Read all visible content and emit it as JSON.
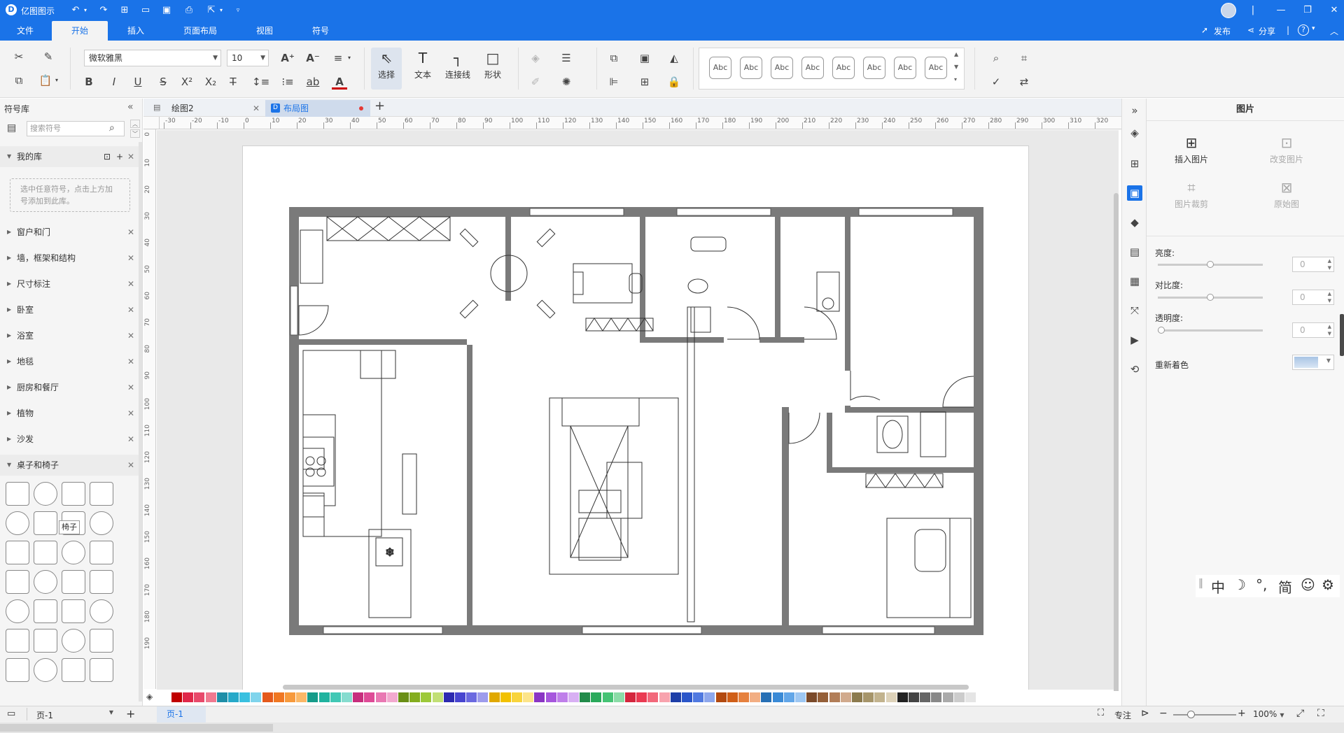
{
  "app": {
    "title": "亿图图示"
  },
  "menu": {
    "tabs": [
      {
        "label": "文件"
      },
      {
        "label": "开始"
      },
      {
        "label": "插入"
      },
      {
        "label": "页面布局"
      },
      {
        "label": "视图"
      },
      {
        "label": "符号"
      }
    ],
    "publish": "发布",
    "share": "分享",
    "help": "?"
  },
  "ribbon": {
    "font_family": "微软雅黑",
    "font_size": "10",
    "select_label": "选择",
    "text_label": "文本",
    "connector_label": "连接线",
    "shape_label": "形状",
    "style_samples": [
      "Abc",
      "Abc",
      "Abc",
      "Abc",
      "Abc",
      "Abc",
      "Abc",
      "Abc"
    ]
  },
  "library": {
    "title": "符号库",
    "search_placeholder": "搜索符号",
    "my_library": "我的库",
    "hint": "选中任意符号，点击上方加号添加到此库。",
    "categories": [
      {
        "label": "窗户和门"
      },
      {
        "label": "墙，框架和结构"
      },
      {
        "label": "尺寸标注"
      },
      {
        "label": "卧室"
      },
      {
        "label": "浴室"
      },
      {
        "label": "地毯"
      },
      {
        "label": "厨房和餐厅"
      },
      {
        "label": "植物"
      },
      {
        "label": "沙发"
      }
    ],
    "open_category": "桌子和椅子",
    "tooltip": "椅子"
  },
  "doc_tabs": [
    {
      "label": "绘图2"
    },
    {
      "label": "布局图"
    }
  ],
  "ruler": {
    "h": [
      "-30",
      "-20",
      "-10",
      "0",
      "10",
      "20",
      "30",
      "40",
      "50",
      "60",
      "70",
      "80",
      "90",
      "100",
      "110",
      "120",
      "130",
      "140",
      "150",
      "160",
      "170",
      "180",
      "190",
      "200",
      "210",
      "220",
      "230",
      "240",
      "250",
      "260",
      "270",
      "280",
      "290",
      "300",
      "310",
      "320"
    ],
    "v": [
      "0",
      "10",
      "20",
      "30",
      "40",
      "50",
      "60",
      "70",
      "80",
      "90",
      "100",
      "110",
      "120",
      "130",
      "140",
      "150",
      "160",
      "170",
      "180",
      "190"
    ]
  },
  "right_panel": {
    "title": "图片",
    "insert_image": "插入图片",
    "change_image": "改变图片",
    "crop_image": "图片裁剪",
    "original_image": "原始图",
    "brightness_label": "亮度:",
    "brightness_value": "0",
    "contrast_label": "对比度:",
    "contrast_value": "0",
    "transparency_label": "透明度:",
    "transparency_value": "0",
    "recolor_label": "重新着色"
  },
  "ime": {
    "chinese": "中",
    "punct": "°,",
    "simp": "简"
  },
  "status": {
    "page_select": "页-1",
    "page_tab": "页-1",
    "focus": "专注",
    "zoom": "100%"
  },
  "palette": [
    "#c00000",
    "#e0284a",
    "#e84a6b",
    "#f07a90",
    "#1f8fa8",
    "#27a9c9",
    "#39c0e0",
    "#7fd4ec",
    "#e45a1c",
    "#f07722",
    "#f79a3c",
    "#fbb867",
    "#169c8a",
    "#20b39f",
    "#41c8b5",
    "#86dccf",
    "#c72e7d",
    "#de4b97",
    "#e978b3",
    "#f2a9cf",
    "#6a8f16",
    "#84ad1f",
    "#9dc93a",
    "#c1df75",
    "#2d2ab0",
    "#4845d0",
    "#6b69e0",
    "#9e9cec",
    "#e0a800",
    "#f2c100",
    "#f8d43c",
    "#fce489",
    "#8a35c4",
    "#a656dd",
    "#bf7fea",
    "#d8b0f3",
    "#228b4a",
    "#2aa95b",
    "#45c374",
    "#8bdca7",
    "#d4263d",
    "#ea3a52",
    "#f2687b",
    "#f8a3ae",
    "#1e3fa8",
    "#2b56c9",
    "#5079e0",
    "#8ea7ec",
    "#b34a10",
    "#d05f18",
    "#e6813e",
    "#f2ae83",
    "#2870b5",
    "#3a8ad6",
    "#62a6e8",
    "#9ec7f2",
    "#7b4a2a",
    "#956039",
    "#b27e58",
    "#d1aa8d",
    "#8c7b4e",
    "#a6956a",
    "#c2b38e",
    "#ddd2b9",
    "#222222",
    "#444444",
    "#666666",
    "#888888",
    "#aaaaaa",
    "#cccccc",
    "#e5e5e5",
    "#ffffff"
  ]
}
